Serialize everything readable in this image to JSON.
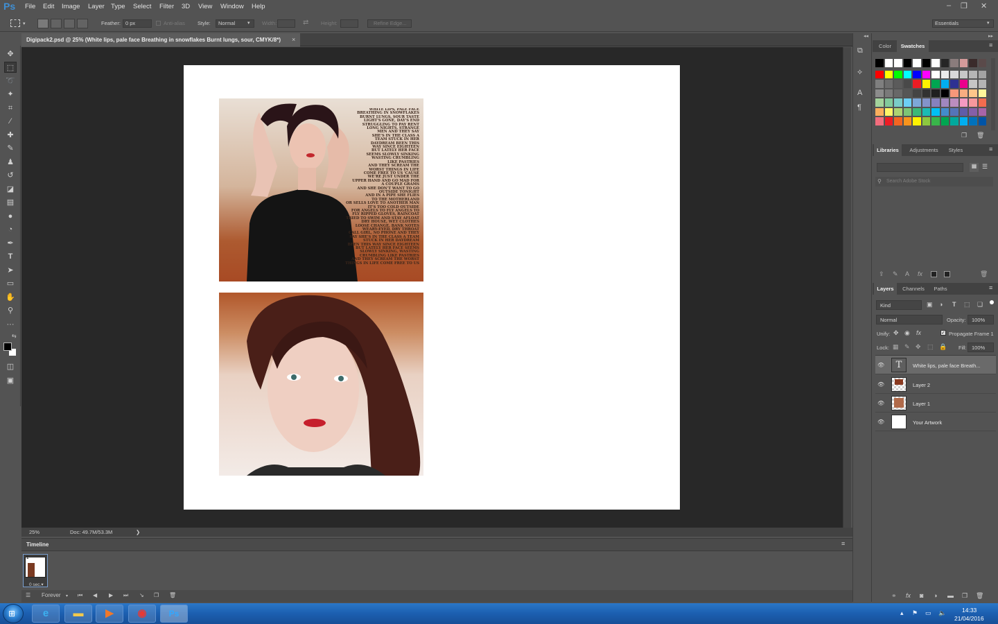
{
  "app": {
    "logo": "Ps",
    "accent_color": "#3f8fd4"
  },
  "menu": [
    "File",
    "Edit",
    "Image",
    "Layer",
    "Type",
    "Select",
    "Filter",
    "3D",
    "View",
    "Window",
    "Help"
  ],
  "window_controls": {
    "minimize": "–",
    "restore": "❐",
    "close": "✕"
  },
  "options": {
    "feather_label": "Feather:",
    "feather_value": "0 px",
    "anti_alias_label": "Anti-alias",
    "style_label": "Style:",
    "style_value": "Normal",
    "width_label": "Width:",
    "height_label": "Height:",
    "refine_edge": "Refine Edge...",
    "workspace": "Essentials"
  },
  "document": {
    "tab_title": "Digipack2.psd @ 25% (White lips, pale face Breathing in snowflakes Burnt lungs, sour, CMYK/8*)",
    "close": "×",
    "lyrics": "White lips, pale face\nBreathing in snowflakes\nBurnt lungs, sour taste\nLight's gone, day's end\nStruggling to pay rent\nLong nights, strange\nmen and they say\nshe's in the class A\nteam stuck in her\ndaydream been this\nway since eighteen\nbut lately her face\nseems slowly sinking\nwasting crumbling\nlike pastries\nand they scream the\nworst things in life\ncome free to us 'cause\nwe're just under the\nupper hand and go mad for\na couple grams\nand she don't want to go\noutside tonight\nand in a pipe she flies\nto the motherland\nor sells love to another man\nit's too cold outside\nfor angels to fly angels to\nfly ripped gloves, raincoat\ntried to swim and stay afloat\ndry house, wet clothes\nloose change, bank notes\nweary-eyed, dry throat\ncall girl, no phone and they\nsay she's in the class A team\nstuck in her daydream\nbeen this way since eighteen\nbut lately her face seems\nslowly sinking, wasting\ncrumbling like pastries\nand they scream the worst\nthings in life come free to us"
  },
  "status": {
    "zoom": "25%",
    "doc": "Doc: 49.7M/53.3M",
    "arrow": "❯"
  },
  "timeline": {
    "title": "Timeline",
    "frame_number": "1",
    "frame_time": "0 sec.▾",
    "loop": "Forever",
    "loop_caret": "▾"
  },
  "swatches": {
    "tabs": [
      "Color",
      "Swatches"
    ],
    "active_tab": "Swatches",
    "rows": [
      [
        "#000000",
        "#ffffff",
        "#ffffff",
        "#000000",
        "#ffffff",
        "#000000",
        "#ffffff",
        "#262626",
        "#8a7c7c",
        "#d49a9a",
        "#3a2b2b",
        "#5a4a4a",
        "#1e1e1e",
        "#141414",
        "#00c26b",
        "#00a651",
        "#f2a2a2"
      ],
      [
        "#ff0000",
        "#ffff00",
        "#00ff00",
        "#00ffff",
        "#0000ff",
        "#ff00ff",
        "#ffffff",
        "#ebebeb",
        "#d9d9d9",
        "#c7c7c7",
        "#b5b5b5",
        "#a3a3a3",
        "#919191"
      ],
      [
        "#7f7f7f",
        "#6d6d6d",
        "#5b5b5b",
        "#494949",
        "#ed1c24",
        "#fff200",
        "#00a651",
        "#00aeef",
        "#2e3192",
        "#ec008c",
        "#c6c6c6",
        "#b4b4b4",
        "#a2a2a2"
      ],
      [
        "#8c8c8c",
        "#7a7a7a",
        "#686868",
        "#565656",
        "#444444",
        "#323232",
        "#202020",
        "#000000",
        "#f7977a",
        "#f9ad81",
        "#fdc68a",
        "#fff79a",
        "#c4df9b"
      ],
      [
        "#a3d39c",
        "#82ca9c",
        "#7accc8",
        "#6dcff6",
        "#7da7d9",
        "#8393ca",
        "#8781bd",
        "#a187be",
        "#bc8dbf",
        "#f49ac2",
        "#f6989d",
        "#f26c4f",
        "#f68e55"
      ],
      [
        "#fbaf5d",
        "#fff467",
        "#acd372",
        "#7cc576",
        "#3bb878",
        "#1abbb4",
        "#00bff3",
        "#438ccb",
        "#5574b9",
        "#605ca8",
        "#855fa8",
        "#a864a8",
        "#f06ea9"
      ],
      [
        "#f26d7d",
        "#ed1c24",
        "#f26522",
        "#f7941d",
        "#fff200",
        "#8dc73f",
        "#39b54a",
        "#00a651",
        "#00a99d",
        "#00aeef",
        "#0072bc",
        "#0054a6",
        "#2e3192"
      ]
    ]
  },
  "libraries": {
    "tabs": [
      "Libraries",
      "Adjustments",
      "Styles"
    ],
    "search_placeholder": "Search Adobe Stock"
  },
  "layers_panel": {
    "tabs": [
      "Layers",
      "Channels",
      "Paths"
    ],
    "kind": "Kind",
    "blend_mode": "Normal",
    "opacity_label": "Opacity:",
    "opacity_value": "100%",
    "unify_label": "Unify:",
    "propagate_label": "Propagate Frame 1",
    "lock_label": "Lock:",
    "fill_label": "Fill:",
    "fill_value": "100%",
    "layers": [
      {
        "name": "White lips, pale face Breath..."
      },
      {
        "name": "Layer 2"
      },
      {
        "name": "Layer 1"
      },
      {
        "name": "Your Artwork"
      }
    ]
  },
  "taskbar": {
    "apps": [
      {
        "name": "internet-explorer",
        "glyph": "e",
        "color": "#3cb0f0"
      },
      {
        "name": "file-explorer",
        "glyph": "▬",
        "color": "#f2c94c"
      },
      {
        "name": "media-player",
        "glyph": "▶",
        "color": "#f0782a"
      },
      {
        "name": "chrome",
        "glyph": "◉",
        "color": "#e53935"
      },
      {
        "name": "photoshop",
        "glyph": "Ps",
        "color": "#31a8ff"
      }
    ],
    "time": "14:33",
    "date": "21/04/2016"
  }
}
